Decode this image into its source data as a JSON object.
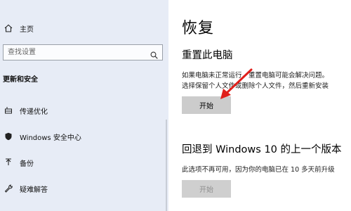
{
  "sidebar": {
    "home_label": "主页",
    "search_placeholder": "查找设置",
    "section_title": "更新和安全",
    "items": [
      {
        "label": "传递优化",
        "icon": "delivery-optimization-icon"
      },
      {
        "label": "Windows 安全中心",
        "icon": "shield-icon"
      },
      {
        "label": "备份",
        "icon": "backup-icon"
      },
      {
        "label": "疑难解答",
        "icon": "wrench-icon"
      }
    ]
  },
  "main": {
    "title": "恢复",
    "reset": {
      "heading": "重置此电脑",
      "line1": "如果电脑未正常运行，重置电脑可能会解决问题。",
      "line2": "选择保留个人文件或删除个人文件，然后重新安装",
      "button": "开始"
    },
    "rollback": {
      "heading": "回退到 Windows 10 的上一个版本",
      "line1": "此选项不再可用，因为你的电脑已在 10 多天前升级",
      "button": "开始"
    }
  },
  "colors": {
    "sidebar_bg": "#e7ecf6",
    "button_bg": "#cccccc",
    "annotation_arrow": "#e0201b"
  }
}
